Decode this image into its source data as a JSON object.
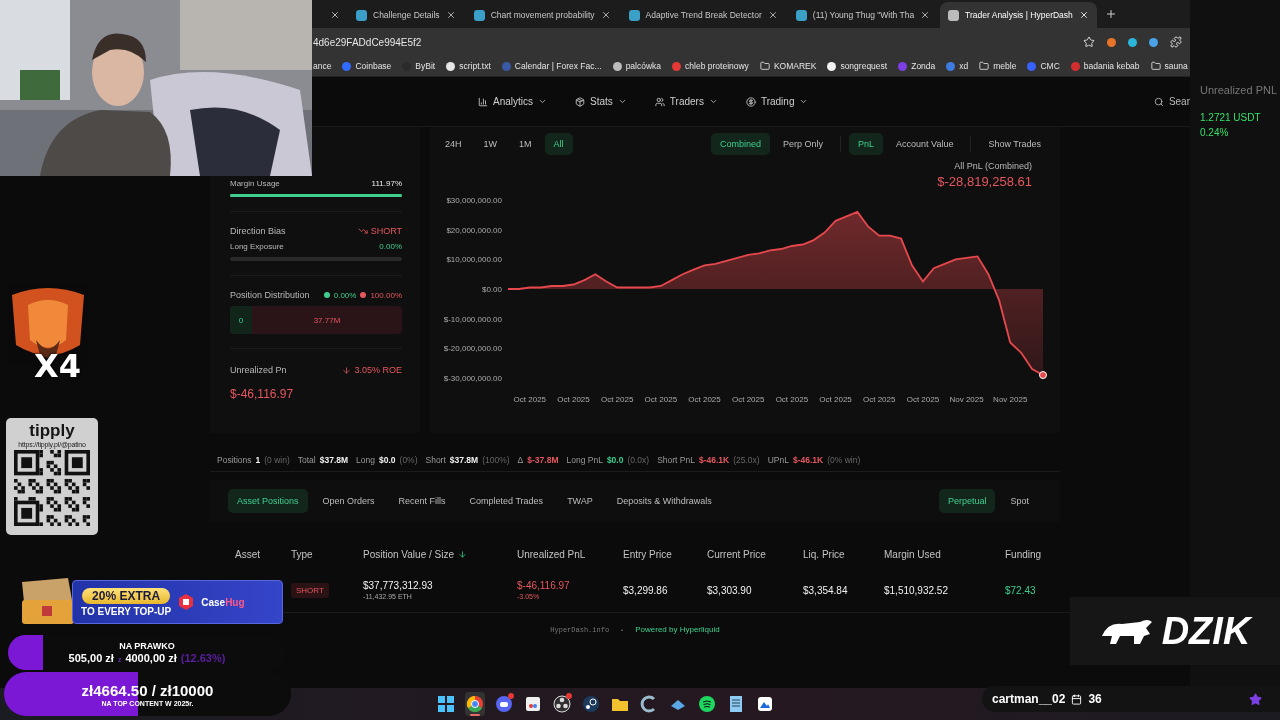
{
  "browser": {
    "tabs": [
      {
        "kind": "cut",
        "selected": false
      },
      {
        "kind": "page",
        "title": "Challenge Details",
        "selected": false
      },
      {
        "kind": "page",
        "title": "Chart movement probability",
        "selected": false
      },
      {
        "kind": "page",
        "title": "Adaptive Trend Break Detector",
        "selected": false
      },
      {
        "kind": "page",
        "title": "(11) Young Thug \"With Tha",
        "selected": false
      },
      {
        "kind": "page",
        "title": "Trader Analysis | HyperDash",
        "selected": true
      }
    ],
    "address": "4d6e29FADdCe994E5f2",
    "bookmarks": [
      {
        "label": "ance",
        "kind": "text"
      },
      {
        "label": "Coinbase",
        "kind": "site",
        "color": "#2f6bff"
      },
      {
        "label": "ByBit",
        "kind": "site",
        "color": "#2a2a2a"
      },
      {
        "label": "script.txt",
        "kind": "site",
        "color": "#e6e6e6"
      },
      {
        "label": "Calendar | Forex Fac...",
        "kind": "site",
        "color": "#3a5aa8"
      },
      {
        "label": "palcówka",
        "kind": "site",
        "color": "#bdbdbd"
      },
      {
        "label": "chleb proteinowy",
        "kind": "site",
        "color": "#e53935"
      },
      {
        "label": "KOMAREK",
        "kind": "folder"
      },
      {
        "label": "songrequest",
        "kind": "site",
        "color": "#f2f2f2"
      },
      {
        "label": "Zonda",
        "kind": "site",
        "color": "#7b3fe4"
      },
      {
        "label": "xd",
        "kind": "site",
        "color": "#3d7be0"
      },
      {
        "label": "meble",
        "kind": "folder"
      },
      {
        "label": "CMC",
        "kind": "site",
        "color": "#3861fb"
      },
      {
        "label": "badania kebab",
        "kind": "site",
        "color": "#d32f2f"
      },
      {
        "label": "sauna",
        "kind": "folder"
      }
    ]
  },
  "right_panel": {
    "label": "Unrealized PNL",
    "value": "1.2721 USDT",
    "change": "0.24%"
  },
  "nav": {
    "items": [
      {
        "label": "Analytics",
        "kind": "chart"
      },
      {
        "label": "Stats",
        "kind": "stats"
      },
      {
        "label": "Traders",
        "kind": "users"
      },
      {
        "label": "Trading",
        "kind": "coin"
      }
    ],
    "search": "Sear"
  },
  "summary": {
    "margin_usage": {
      "label": "Margin Usage",
      "value": "111.97%",
      "level": 1
    },
    "direction_bias": {
      "label": "Direction Bias",
      "value": "SHORT"
    },
    "long_exposure": {
      "label": "Long Exposure",
      "value": "0.00%",
      "level": 0
    },
    "position_distribution": {
      "label": "Position Distribution",
      "long_share": "0.00%",
      "short_share": "100.00%",
      "long_value": "0",
      "short_value": "37.77M",
      "level": 0
    },
    "unrealized_pnl": {
      "label": "Unrealized Pn",
      "roe": "3.05% ROE",
      "value": "$-46,116.97"
    }
  },
  "chart_panel": {
    "ranges": [
      {
        "label": "24H",
        "selected": false
      },
      {
        "label": "1W",
        "selected": false
      },
      {
        "label": "1M",
        "selected": false
      },
      {
        "label": "All",
        "selected": true
      }
    ],
    "modes": [
      {
        "label": "Combined",
        "selected": true
      },
      {
        "label": "Perp Only",
        "selected": false
      }
    ],
    "metrics": [
      {
        "label": "PnL",
        "selected": true
      },
      {
        "label": "Account Value",
        "selected": false
      }
    ],
    "show_trades": "Show Trades",
    "caption": "All PnL (Combined)",
    "total": "$-28,819,258.61",
    "chart_data": {
      "type": "area",
      "categories": [
        null,
        null,
        "Oct 2025",
        null,
        null,
        null,
        "Oct 2025",
        null,
        null,
        null,
        "Oct 2025",
        null,
        null,
        null,
        "Oct 2025",
        null,
        null,
        null,
        "Oct 2025",
        null,
        null,
        null,
        "Oct 2025",
        null,
        null,
        null,
        "Oct 2025",
        null,
        null,
        null,
        "Oct 2025",
        null,
        null,
        null,
        "Oct 2025",
        null,
        null,
        null,
        "Oct 2025",
        null,
        null,
        null,
        "Nov 2025",
        null,
        null,
        null,
        "Nov 2025",
        null,
        null,
        null
      ],
      "series": [
        {
          "color": "#e5484d",
          "values": [
            0,
            0,
            500000,
            500000,
            1000000,
            1000000,
            1500000,
            3000000,
            5000000,
            2500000,
            500000,
            500000,
            500000,
            500000,
            1000000,
            3000000,
            5000000,
            6500000,
            8000000,
            8500000,
            9500000,
            10500000,
            11500000,
            12000000,
            13000000,
            13500000,
            14500000,
            15000000,
            16500000,
            19000000,
            23000000,
            24500000,
            26000000,
            21000000,
            18000000,
            18000000,
            17000000,
            8000000,
            2500000,
            7000000,
            8500000,
            10000000,
            10500000,
            11000000,
            5000000,
            -4000000,
            -18000000,
            -21500000,
            -27000000,
            -29000000
          ]
        }
      ],
      "ylim": [
        -30000000,
        30000000
      ],
      "yticks": [
        {
          "value": 30000000,
          "label": "$30,000,000.00"
        },
        {
          "value": 20000000,
          "label": "$20,000,000.00"
        },
        {
          "value": 10000000,
          "label": "$10,000,000.00"
        },
        {
          "value": 0,
          "label": "$0.00"
        },
        {
          "value": -10000000,
          "label": "$-10,000,000.00"
        },
        {
          "value": -20000000,
          "label": "$-20,000,000.00"
        },
        {
          "value": -30000000,
          "label": "$-30,000,000.00"
        }
      ]
    }
  },
  "stats_bar": [
    {
      "label": "Positions",
      "value": "1",
      "note": "(0 win)",
      "color": "#f2f2f2"
    },
    {
      "label": "Total",
      "value": "$37.8M",
      "color": "#f2f2f2"
    },
    {
      "label": "Long",
      "value": "$0.0",
      "note": "(0%)",
      "color": "#f2f2f2"
    },
    {
      "label": "Short",
      "value": "$37.8M",
      "note": "(100%)",
      "color": "#f2f2f2"
    },
    {
      "label": "Δ",
      "value": "$-37.8M",
      "color": "#e5575f"
    },
    {
      "label": "Long PnL",
      "value": "$0.0",
      "note": "(0.0x)",
      "color": "#3ecf8e"
    },
    {
      "label": "Short PnL",
      "value": "$-46.1K",
      "note": "(25.0x)",
      "color": "#e5575f"
    },
    {
      "label": "UPnL",
      "value": "$-46.1K",
      "note": "(0% win)",
      "color": "#e5575f"
    }
  ],
  "tabs": [
    {
      "label": "Asset Positions",
      "selected": true
    },
    {
      "label": "Open Orders",
      "selected": false
    },
    {
      "label": "Recent Fills",
      "selected": false
    },
    {
      "label": "Completed Trades",
      "selected": false
    },
    {
      "label": "TWAP",
      "selected": false
    },
    {
      "label": "Deposits & Withdrawals",
      "selected": false
    }
  ],
  "market_tabs": [
    {
      "label": "Perpetual",
      "selected": true
    },
    {
      "label": "Spot",
      "selected": false
    }
  ],
  "table": {
    "columns": [
      {
        "label": "Asset",
        "sorted": false
      },
      {
        "label": "Type",
        "sorted": false
      },
      {
        "label": "Position Value / Size",
        "sorted": true
      },
      {
        "label": "Unrealized PnL",
        "sorted": false
      },
      {
        "label": "Entry Price",
        "sorted": false
      },
      {
        "label": "Current Price",
        "sorted": false
      },
      {
        "label": "Liq. Price",
        "sorted": false
      },
      {
        "label": "Margin Used",
        "sorted": false
      },
      {
        "label": "Funding",
        "sorted": false
      }
    ],
    "rows": [
      {
        "type": "SHORT",
        "value": "$37,773,312.93",
        "size": "-11,432.95 ETH",
        "pnl": "$-46,116.97",
        "pnl_pct": "-3.05%",
        "entry": "$3,299.86",
        "current": "$3,303.90",
        "liq": "$3,354.84",
        "margin": "$1,510,932.52",
        "funding": "$72.43"
      }
    ]
  },
  "footer": {
    "site": "HyperDash.info",
    "separator": "•",
    "powered": "Powered by Hyperliquid"
  },
  "overlays": {
    "emote": {
      "kind": "picture",
      "count": "X4"
    },
    "tip_card": {
      "brand": "tipply",
      "url": "https://tipply.pl/@patino"
    },
    "promo": {
      "headline": "20% EXTRA",
      "subline": "TO EVERY TOP-UP",
      "brand_a": "Case",
      "brand_b": "Hug"
    },
    "goal_1": {
      "title": "NA PRAWKO",
      "current": "505,00 zł",
      "divider": "z",
      "target": "4000,00 zł",
      "percent": "(12.63%)",
      "level": 0.1263
    },
    "goal_2": {
      "amount": "zł4664.50 / zł10000",
      "title": "NA TOP CONTENT W 2025r.",
      "level": 0.4665
    },
    "logo": {
      "text": "DZIK"
    },
    "chat_user": {
      "name": "cartman__02",
      "count": "36"
    }
  },
  "taskbar": {
    "apps": [
      {
        "kind": "windows",
        "active": false,
        "badge": false
      },
      {
        "kind": "chrome",
        "active": true,
        "badge": false
      },
      {
        "kind": "discord",
        "active": false,
        "badge": true
      },
      {
        "kind": "snip",
        "active": false,
        "badge": false
      },
      {
        "kind": "obs",
        "active": false,
        "badge": true
      },
      {
        "kind": "steam",
        "active": false,
        "badge": false
      },
      {
        "kind": "folder",
        "active": false,
        "badge": false
      },
      {
        "kind": "cleaner",
        "active": false,
        "badge": false
      },
      {
        "kind": "tool",
        "active": false,
        "badge": false
      },
      {
        "kind": "spotify",
        "active": false,
        "badge": false
      },
      {
        "kind": "notepad",
        "active": false,
        "badge": false
      },
      {
        "kind": "photos",
        "active": false,
        "badge": false
      }
    ]
  }
}
